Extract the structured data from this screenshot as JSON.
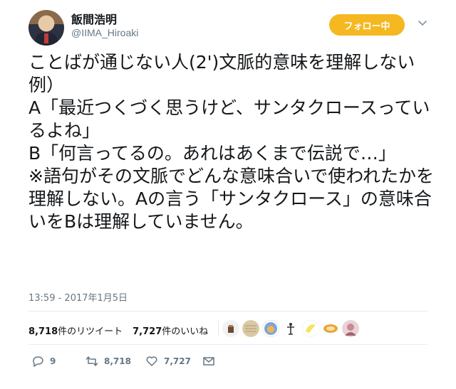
{
  "user": {
    "display_name": "飯間浩明",
    "handle": "@IIMA_Hiroaki",
    "follow_label": "フォロー中"
  },
  "tweet": {
    "text": "ことばが通じない人(2')文脈的意味を理解しない\n例）\nA「最近つくづく思うけど、サンタクロースっているよね」\nB「何言ってるの。あれはあくまで伝説で…」\n※語句がその文脈でどんな意味合いで使われたかを理解しない。Aの言う「サンタクロース」の意味合いをBは理解していません。",
    "timestamp": "13:59 - 2017年1月5日"
  },
  "stats": {
    "retweets_count": "8,718",
    "retweets_label": "件のリツイート",
    "likes_count": "7,727",
    "likes_label": "件のいいね"
  },
  "actions": {
    "reply_count": "9",
    "retweet_count": "8,718",
    "like_count": "7,727"
  },
  "icons": [
    "avatar",
    "chevron-down-icon",
    "reply-icon",
    "retweet-icon",
    "like-icon",
    "message-icon"
  ],
  "colors": {
    "follow_button": "#f5b820",
    "secondary_text": "#657786",
    "divider": "#e6ecf0"
  }
}
